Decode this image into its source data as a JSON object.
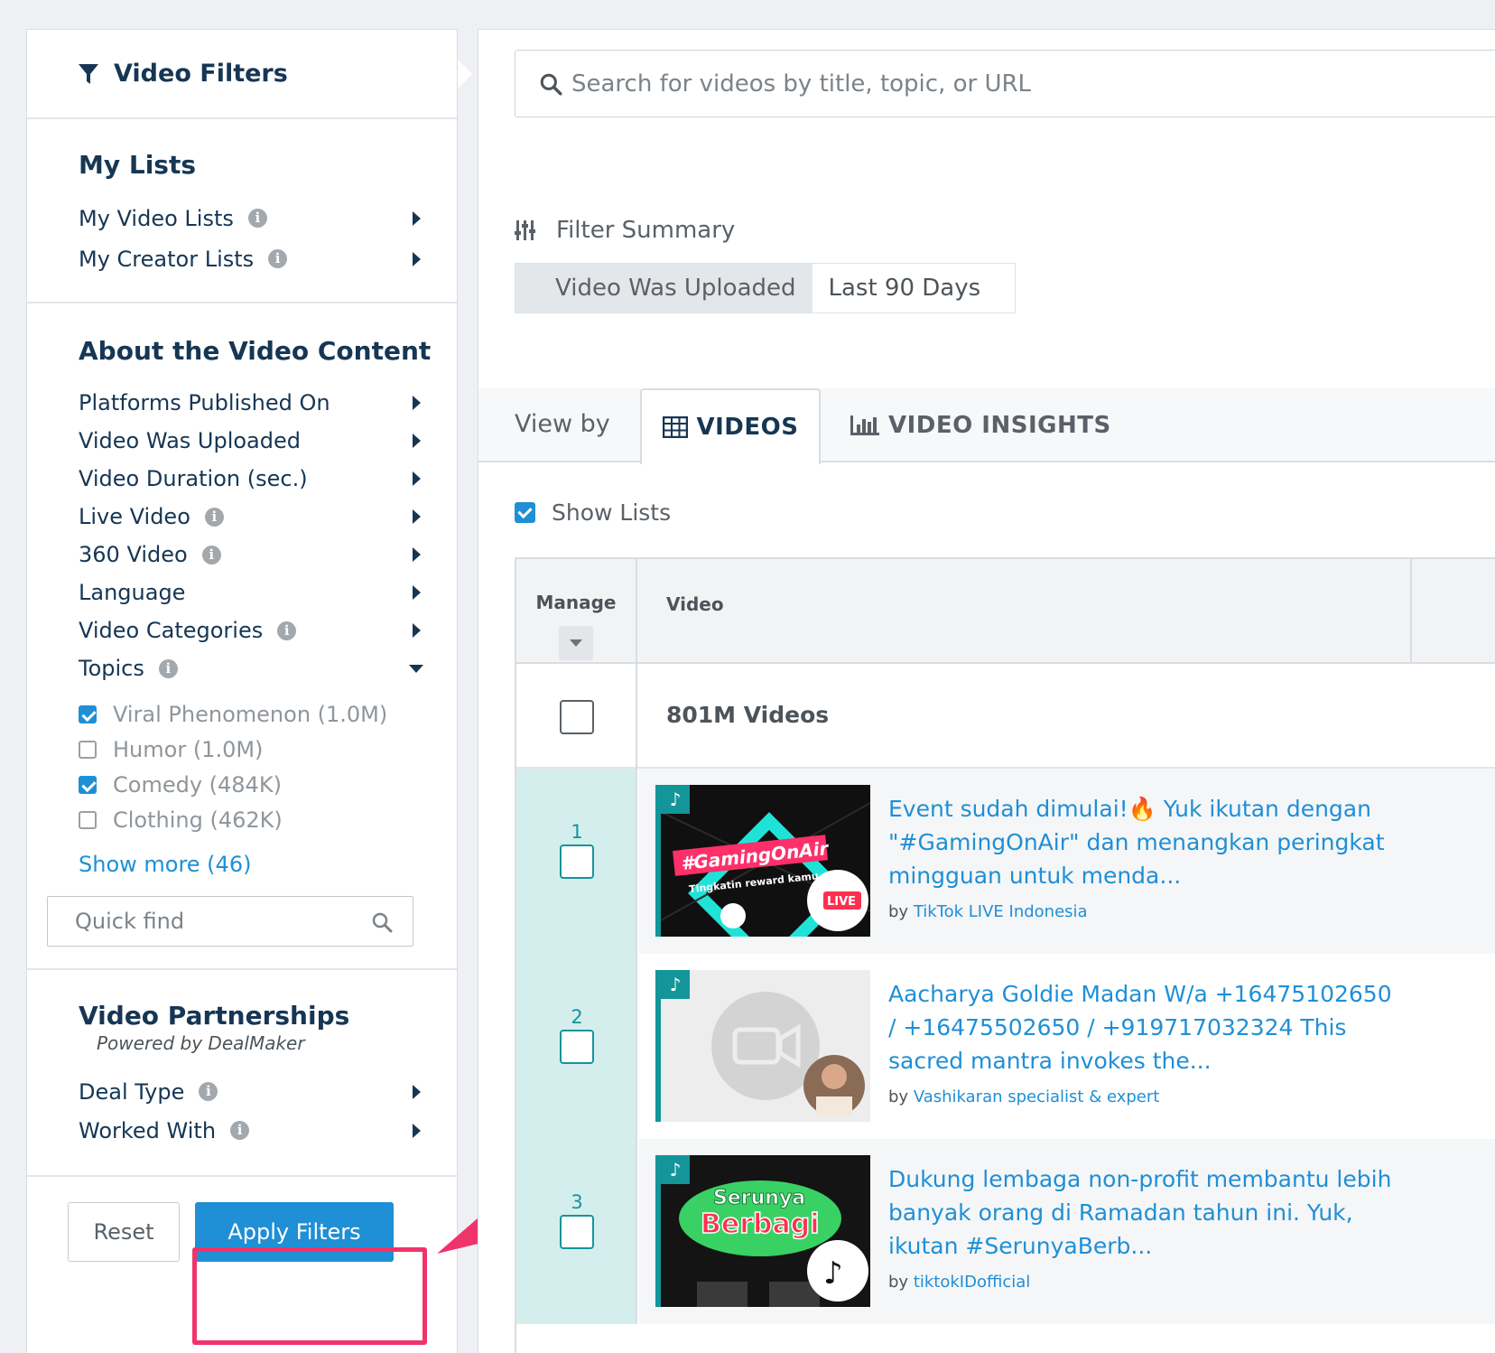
{
  "sidebar": {
    "header_title": "Video Filters",
    "my_lists": {
      "title": "My Lists",
      "items": [
        {
          "label": "My Video Lists",
          "info": true
        },
        {
          "label": "My Creator Lists",
          "info": true
        }
      ]
    },
    "about": {
      "title": "About the Video Content",
      "items": [
        {
          "label": "Platforms Published On"
        },
        {
          "label": "Video Was Uploaded"
        },
        {
          "label": "Video Duration (sec.)"
        },
        {
          "label": "Live Video"
        },
        {
          "label": "360 Video"
        },
        {
          "label": "Language"
        },
        {
          "label": "Video Categories"
        },
        {
          "label": "Topics"
        }
      ],
      "topics": [
        {
          "label": "Viral Phenomenon (1.0M)",
          "checked": true
        },
        {
          "label": "Humor (1.0M)",
          "checked": false
        },
        {
          "label": "Comedy (484K)",
          "checked": true
        },
        {
          "label": "Clothing (462K)",
          "checked": false
        }
      ],
      "show_more": "Show more (46)",
      "quick_find_placeholder": "Quick find"
    },
    "partnerships": {
      "title": "Video Partnerships",
      "subtitle": "Powered by DealMaker",
      "items": [
        {
          "label": "Deal Type"
        },
        {
          "label": "Worked With"
        }
      ]
    },
    "reset_label": "Reset",
    "apply_label": "Apply Filters"
  },
  "main": {
    "search_placeholder": "Search for videos by title, topic, or URL",
    "filter_summary_title": "Filter Summary",
    "chip_key": "Video Was Uploaded",
    "chip_value": "Last 90 Days",
    "view_by": "View by",
    "tabs": [
      {
        "label": "VIDEOS",
        "active": true
      },
      {
        "label": "VIDEO INSIGHTS",
        "active": false
      }
    ],
    "show_lists_label": "Show Lists",
    "table": {
      "col_manage": "Manage",
      "col_video": "Video",
      "count": "801M Videos",
      "rows": [
        {
          "num": "1",
          "title": "Event sudah dimulai!🔥 Yuk ikutan dengan \"#GamingOnAir\" dan menangkan peringkat mingguan untuk menda...",
          "by": "by",
          "creator": "TikTok LIVE Indonesia",
          "thumb_text_1": "#GamingOnAir",
          "thumb_text_2": "Tingkatin reward kamu",
          "thumb_badge": "LIVE"
        },
        {
          "num": "2",
          "title": "Aacharya Goldie Madan W/a +16475102650 / +16475502650 / +919717032324 This sacred mantra invokes the...",
          "by": "by",
          "creator": "Vashikaran specialist & expert"
        },
        {
          "num": "3",
          "title": "Dukung lembaga non-profit membantu lebih banyak orang di Ramadan tahun ini. Yuk, ikutan #SerunyaBerb...",
          "by": "by",
          "creator": "tiktokIDofficial",
          "thumb_text_1": "Serunya",
          "thumb_text_2": "Berbagi"
        }
      ]
    }
  },
  "colors": {
    "accent_blue": "#1f8fd6",
    "teal": "#13959a",
    "highlight_pink": "#f0336b",
    "navy": "#163654"
  }
}
